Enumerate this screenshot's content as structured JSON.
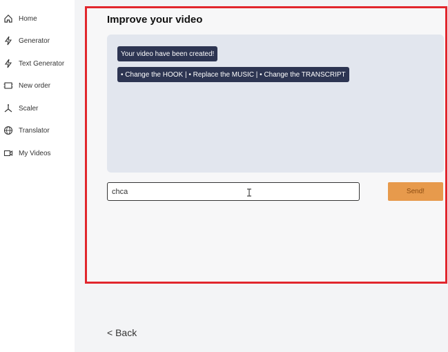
{
  "sidebar": {
    "items": [
      {
        "label": "Home",
        "icon": "home-icon"
      },
      {
        "label": "Generator",
        "icon": "bolt-icon"
      },
      {
        "label": "Text Generator",
        "icon": "bolt-icon"
      },
      {
        "label": "New order",
        "icon": "video-frame-icon"
      },
      {
        "label": "Scaler",
        "icon": "scale-icon"
      },
      {
        "label": "Translator",
        "icon": "globe-icon"
      },
      {
        "label": "My Videos",
        "icon": "video-camera-icon"
      }
    ]
  },
  "main": {
    "title": "Improve your video",
    "messages": [
      "Your video have been created!",
      "• Change the HOOK | • Replace the MUSIC | • Change the TRANSCRIPT"
    ],
    "input_value": "chca",
    "send_label": "Send!",
    "back_label": "< Back"
  },
  "colors": {
    "highlight_border": "#e1262d",
    "bubble_bg": "#2d3552",
    "chat_bg": "#e2e6ee",
    "send_bg": "#e79a4c"
  }
}
